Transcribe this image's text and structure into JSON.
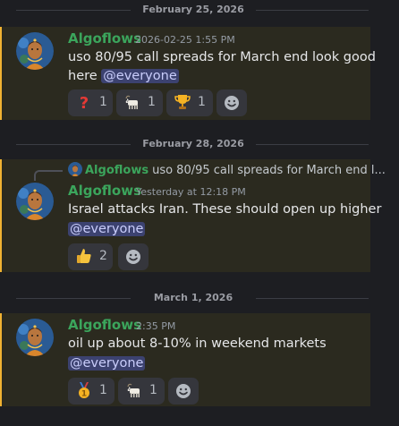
{
  "dividers": [
    "February 25, 2026",
    "February 28, 2026",
    "March 1, 2026"
  ],
  "messages": [
    {
      "author": "Algoflows",
      "timestamp": "2026-02-25 1:55 PM",
      "line1": "uso 80/95 call spreads for March end look good",
      "line2_text": "here",
      "mention": "@everyone",
      "reactions": [
        {
          "emoji": "question-icon",
          "count": "1"
        },
        {
          "emoji": "goat-icon",
          "count": "1"
        },
        {
          "emoji": "trophy-icon",
          "count": "1"
        }
      ]
    },
    {
      "reply": {
        "author": "Algoflows",
        "preview": "uso 80/95 call spreads for March end l..."
      },
      "author": "Algoflows",
      "timestamp": "Yesterday at 12:18 PM",
      "line1": "Israel attacks Iran. These should open up higher",
      "mention": "@everyone",
      "reactions": [
        {
          "emoji": "thumbs-up-icon",
          "count": "2"
        }
      ]
    },
    {
      "author": "Algoflows",
      "timestamp": "2:35 PM",
      "line1": "oil up about 8-10% in weekend markets",
      "mention": "@everyone",
      "reactions": [
        {
          "emoji": "first-place-medal-icon",
          "count": "1"
        },
        {
          "emoji": "goat-icon",
          "count": "1"
        }
      ]
    }
  ],
  "colors": {
    "background": "#1d1e22",
    "highlight": "#2b2a1f",
    "highlight_border": "#f0b232",
    "author": "#3ba55c",
    "mention_bg": "#3c4270",
    "mention_fg": "#c9cdfb"
  }
}
